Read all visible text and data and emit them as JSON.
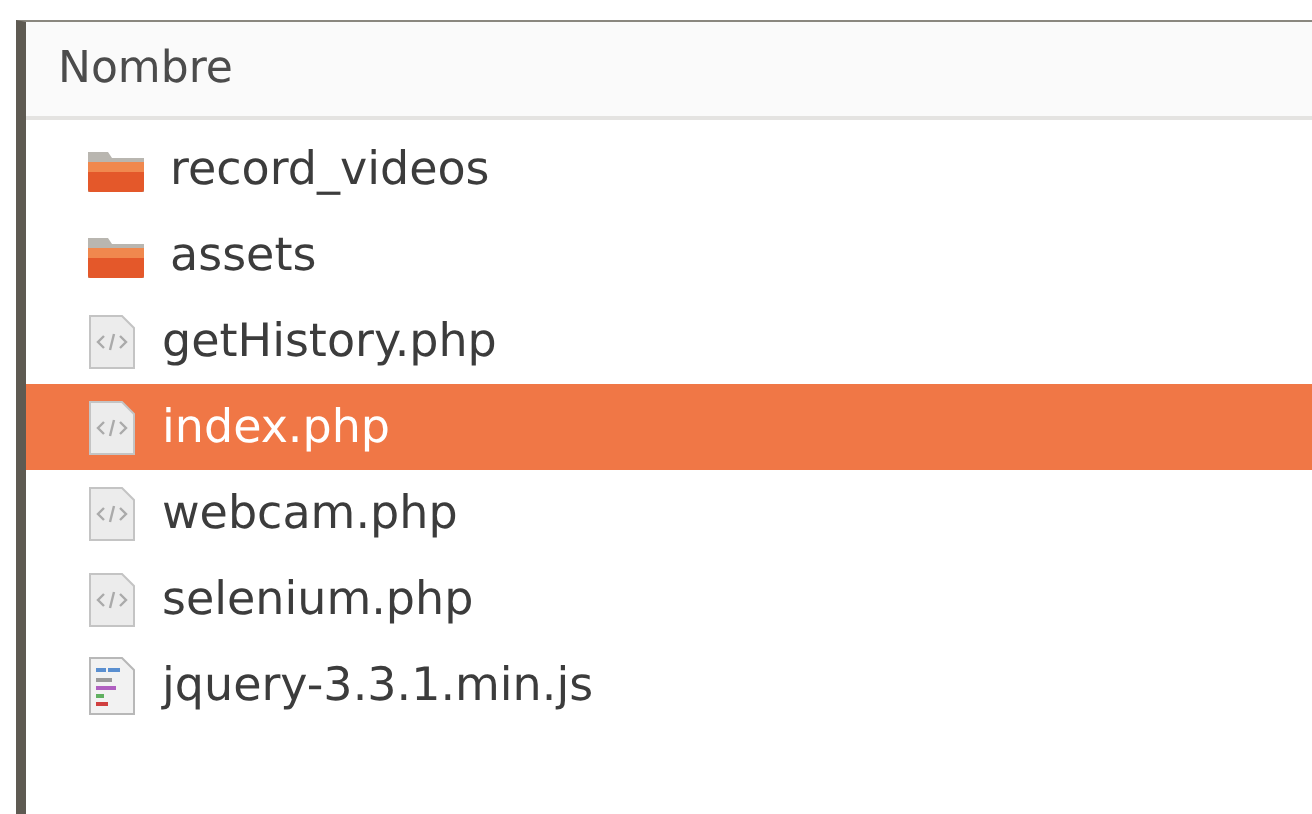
{
  "column_header": "Nombre",
  "files": [
    {
      "name": "record_videos",
      "kind": "folder",
      "selected": false
    },
    {
      "name": "assets",
      "kind": "folder",
      "selected": false
    },
    {
      "name": "getHistory.php",
      "kind": "php",
      "selected": false
    },
    {
      "name": "index.php",
      "kind": "php",
      "selected": true
    },
    {
      "name": "webcam.php",
      "kind": "php",
      "selected": false
    },
    {
      "name": "selenium.php",
      "kind": "php",
      "selected": false
    },
    {
      "name": "jquery-3.3.1.min.js",
      "kind": "js",
      "selected": false
    }
  ]
}
